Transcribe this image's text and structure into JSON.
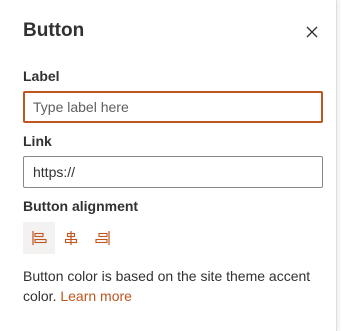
{
  "panel": {
    "title": "Button",
    "close_icon": "close-icon"
  },
  "label_field": {
    "label": "Label",
    "placeholder": "Type label here",
    "value": ""
  },
  "link_field": {
    "label": "Link",
    "value": "https://"
  },
  "alignment": {
    "label": "Button alignment",
    "options": [
      {
        "icon": "align-left-icon",
        "selected": true
      },
      {
        "icon": "align-center-icon",
        "selected": false
      },
      {
        "icon": "align-right-icon",
        "selected": false
      }
    ]
  },
  "note": {
    "text": "Button color is based on the site theme accent color.",
    "link": "Learn more"
  },
  "colors": {
    "accent": "#c0561f",
    "text": "#323130",
    "border": "#8a8886"
  }
}
